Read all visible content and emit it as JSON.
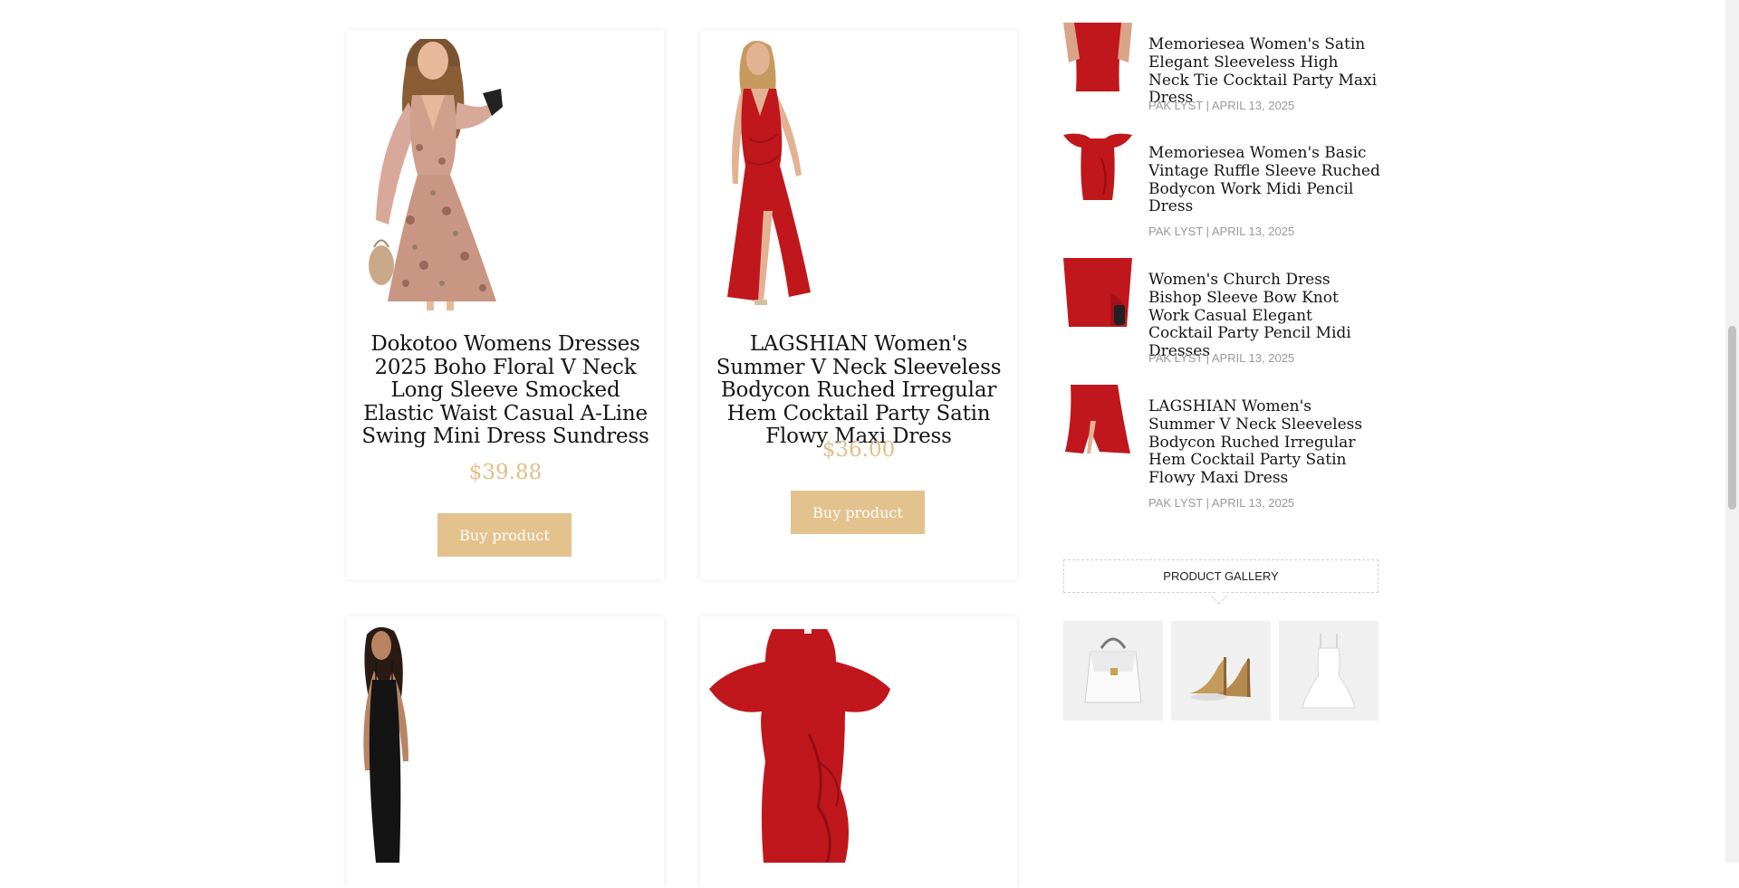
{
  "products": [
    {
      "title": "Dokotoo Womens Dresses 2025 Boho Floral V Neck Long Sleeve Smocked Elastic Waist Casual A-Line Swing Mini Dress Sundress",
      "price": "$39.88",
      "button": "Buy product"
    },
    {
      "title": "LAGSHIAN Women's Summer V Neck Sleeveless Bodycon Ruched Irregular Hem Cocktail Party Satin Flowy Maxi Dress",
      "price": "$36.00",
      "button": "Buy product"
    }
  ],
  "sidebar": {
    "recent_posts": [
      {
        "title": "Memoriesea Women's Satin Elegant Sleeveless High Neck Tie Cocktail Party Maxi Dress",
        "meta": "PAK LYST | APRIL 13, 2025"
      },
      {
        "title": "Memoriesea Women's Basic Vintage Ruffle Sleeve Ruched Bodycon Work Midi Pencil Dress",
        "meta": "PAK LYST | APRIL 13, 2025"
      },
      {
        "title": "Women's Church Dress Bishop Sleeve Bow Knot Work Casual Elegant Cocktail Party Pencil Midi Dresses",
        "meta": "PAK LYST | APRIL 13, 2025"
      },
      {
        "title": "LAGSHIAN Women's Summer V Neck Sleeveless Bodycon Ruched Irregular Hem Cocktail Party Satin Flowy Maxi Dress",
        "meta": "PAK LYST | APRIL 13, 2025"
      }
    ],
    "gallery_heading": "PRODUCT GALLERY"
  },
  "colors": {
    "accent": "#e4c28e",
    "price": "#e2be88",
    "dress_red": "#c0171c"
  }
}
